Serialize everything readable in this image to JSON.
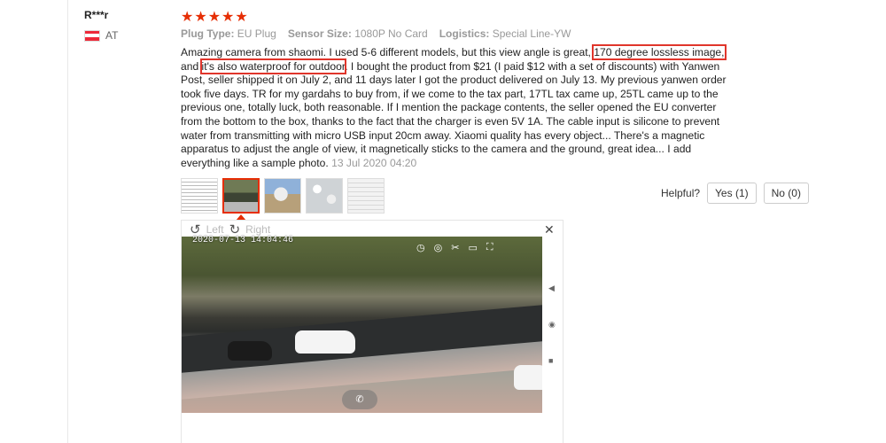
{
  "user": {
    "name": "R***r",
    "country": "AT"
  },
  "rating": {
    "stars": "★★★★★"
  },
  "attributes": [
    {
      "label": "Plug Type:",
      "value": "EU Plug"
    },
    {
      "label": "Sensor Size:",
      "value": "1080P No Card"
    },
    {
      "label": "Logistics:",
      "value": "Special Line-YW"
    }
  ],
  "review": {
    "part1": "Amazing camera from shaomi. I used 5-6 different models, but this view angle is great, ",
    "highlight1": "170 degree lossless image,",
    "part2": " and ",
    "highlight2": "it's also waterproof for outdoor",
    "part3": ". I bought the product from $21 (I paid $12 with a set of discounts) with Yanwen Post, seller shipped it on July 2, and 11 days later I got the product delivered on July 13. My previous yanwen order took five days. TR for my gardahs to buy from, if we come to the tax part, 17TL tax came up, 25TL came up to the previous one, totally luck, both reasonable. If I mention the package contents, the seller opened the EU converter from the bottom to the box, thanks to the fact that the charger is even 5V 1A. The cable input is silicone to prevent water from transmitting with micro USB input 20cm away. Xiaomi quality has every object... There's a magnetic apparatus to adjust the angle of view, it magnetically sticks to the camera and the ground, great idea... I add everything like a sample photo. ",
    "date": "13 Jul 2020 04:20"
  },
  "helpful": {
    "label": "Helpful?",
    "yes": "Yes (1)",
    "no": "No (0)"
  },
  "viewer": {
    "rotate_left": "Left",
    "rotate_right": "Right",
    "close": "✕",
    "timestamp": "2020-07-13 14:04:46",
    "icons": [
      "clock-icon",
      "target-icon",
      "scissors-icon",
      "video-icon",
      "fullscreen-icon"
    ]
  },
  "colors": {
    "accent": "#e62e04",
    "highlight_box": "#e0352b"
  }
}
